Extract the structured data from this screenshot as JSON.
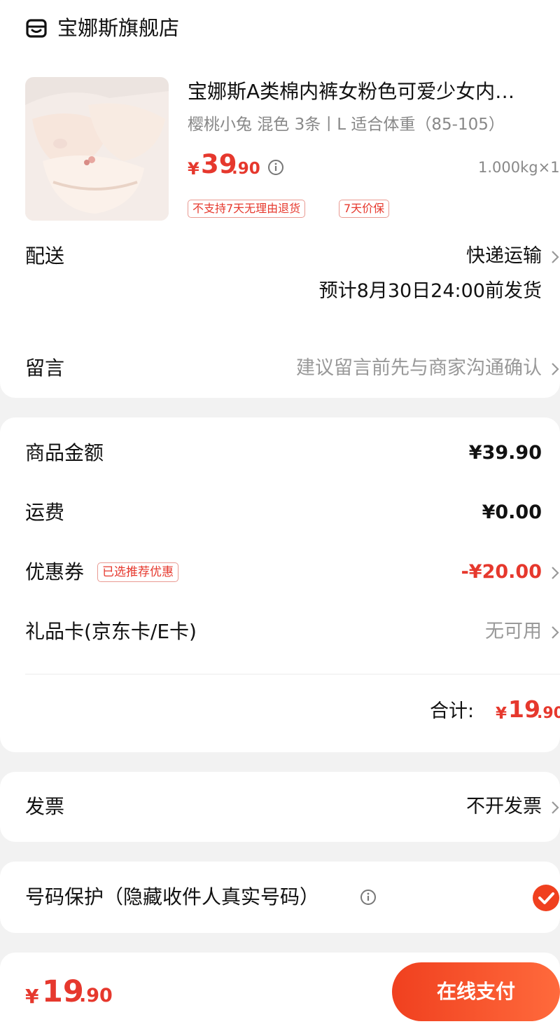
{
  "store": {
    "name": "宝娜斯旗舰店",
    "icon": "store-icon"
  },
  "product": {
    "title": "宝娜斯A类棉内裤女粉色可爱少女内…",
    "spec": "樱桃小兔 混色 3条丨L 适合体重（85-105）",
    "price_symbol": "¥",
    "price_integer": "39",
    "price_decimal": ".90",
    "weight_qty": "1.000kg×1",
    "tags": [
      "不支持7天无理由退货",
      "7天价保"
    ]
  },
  "delivery": {
    "label": "配送",
    "method": "快递运输",
    "estimate": "预计8月30日24:00前发货"
  },
  "message": {
    "label": "留言",
    "placeholder": "建议留言前先与商家沟通确认"
  },
  "summary": {
    "goods_label": "商品金额",
    "goods_value": "¥39.90",
    "shipping_label": "运费",
    "shipping_value": "¥0.00",
    "coupon_label": "优惠券",
    "coupon_tag": "已选推荐优惠",
    "coupon_value": "-¥20.00",
    "giftcard_label": "礼品卡(京东卡/E卡)",
    "giftcard_value": "无可用",
    "total_label": "合计:",
    "total_symbol": "¥",
    "total_integer": "19",
    "total_decimal": ".90"
  },
  "invoice": {
    "label": "发票",
    "value": "不开发票"
  },
  "privacy": {
    "label": "号码保护（隐藏收件人真实号码）",
    "checked": true
  },
  "footer": {
    "price_symbol": "¥",
    "price_integer": "19",
    "price_decimal": ".90",
    "pay_label": "在线支付"
  },
  "colors": {
    "accent": "#e6382d",
    "button": "#f0401f",
    "text": "#111111",
    "muted": "#999999"
  }
}
